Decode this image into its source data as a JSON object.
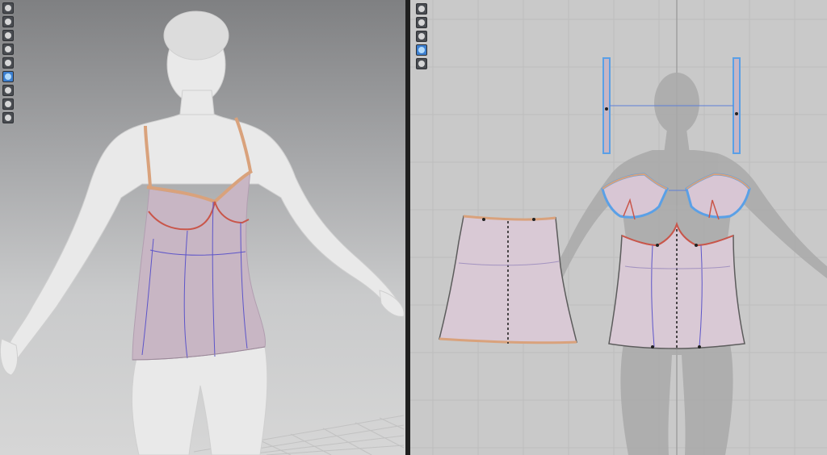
{
  "app": {
    "panes": [
      "3d-avatar-view",
      "2d-pattern-view"
    ]
  },
  "toolbar_3d": {
    "icons": [
      "simulation-icon",
      "select-move-icon",
      "arrange-points-icon",
      "fold-arrangement-icon",
      "pin-icon",
      "texture-surface-icon",
      "stretch-map-icon",
      "avatar-display-icon",
      "garment-display-icon"
    ],
    "active_index": 5
  },
  "toolbar_2d": {
    "icons": [
      "transform-pattern-icon",
      "edit-point-icon",
      "segment-sewing-icon",
      "internal-line-icon",
      "lock-icon"
    ],
    "active_index": 3
  },
  "colors": {
    "fabric": "#c8b6c4",
    "seam_orange": "#d9a27c",
    "seam_red": "#c9564a",
    "internal_line": "#5d55c9",
    "selected_outline": "#5aa0e6",
    "grid": "#bdbdbd"
  },
  "pattern_pieces": [
    "strap-left",
    "strap-right",
    "cup-left",
    "cup-right",
    "front-body",
    "back-body"
  ]
}
